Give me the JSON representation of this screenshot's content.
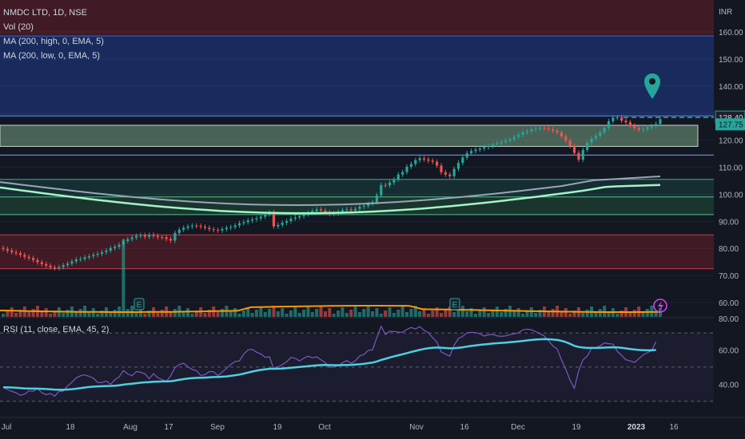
{
  "legend": {
    "symbol": "NMDC LTD, 1D, NSE",
    "volume": "Vol (20)",
    "ma_high": "MA (200, high, 0, EMA, 5)",
    "ma_low": "MA (200, low, 0, EMA, 5)"
  },
  "rsi_label": "RSI (11, close, EMA, 45, 2)",
  "colors": {
    "background": "#131722",
    "up": "#26a69a",
    "down": "#ef5350",
    "ma_high": "#9aa6b8",
    "ma_low": "#a5f3c8",
    "volume_ma": "#ff9800",
    "rsi": "#7e57c2",
    "rsi_ma": "#4dd0e1",
    "price_tag_last": "#26a69a",
    "price_tag_ref": "#1e222d"
  },
  "chart_data": [
    {
      "type": "candlestick",
      "title": "NMDC LTD, 1D, NSE",
      "currency": "INR",
      "x": [
        "Jul",
        "18",
        "Aug",
        "17",
        "Sep",
        "19",
        "Oct",
        "Nov",
        "16",
        "Dec",
        "19",
        "2023",
        "16"
      ],
      "y_ticks": [
        60,
        70,
        80,
        90,
        100,
        110,
        120,
        130,
        140,
        150,
        160
      ],
      "y_tick_labels": [
        "60.00",
        "70.00",
        "80.00",
        "90.00",
        "100.00",
        "110.00",
        "120.00",
        "130.00",
        "140.00",
        "150.00",
        "160.00"
      ],
      "ylim": [
        55,
        168
      ],
      "last_price": 127.75,
      "reference_price": 128.4,
      "closes": [
        79.8,
        79.2,
        78.6,
        78.2,
        77.6,
        76.9,
        76.4,
        75.7,
        74.9,
        74.2,
        73.6,
        73.0,
        72.7,
        73.1,
        73.8,
        74.4,
        75.2,
        75.9,
        76.1,
        76.7,
        77.1,
        77.6,
        78.0,
        78.6,
        79.2,
        80.1,
        80.6,
        81.4,
        82.7,
        83.4,
        84.0,
        84.6,
        84.9,
        84.3,
        85.0,
        84.6,
        84.2,
        84.1,
        83.5,
        82.9,
        85.7,
        86.9,
        87.6,
        88.1,
        88.4,
        88.3,
        88.0,
        87.6,
        87.1,
        86.8,
        86.6,
        87.1,
        87.6,
        87.9,
        88.5,
        89.3,
        89.7,
        90.3,
        90.7,
        91.1,
        91.7,
        92.6,
        93.3,
        88.1,
        88.7,
        89.5,
        90.1,
        91.0,
        91.4,
        91.9,
        92.6,
        93.2,
        93.8,
        94.4,
        94.0,
        93.3,
        92.7,
        92.9,
        93.6,
        94.2,
        94.4,
        94.0,
        94.6,
        95.4,
        95.7,
        96.5,
        97.1,
        99.6,
        103.4,
        103.3,
        104.3,
        105.5,
        107.3,
        108.2,
        110.2,
        111.2,
        112.6,
        113.3,
        112.9,
        112.4,
        112.0,
        110.6,
        108.1,
        107.3,
        106.7,
        109.4,
        111.6,
        113.6,
        115.2,
        116.0,
        116.5,
        116.9,
        117.4,
        117.8,
        118.4,
        118.9,
        119.3,
        119.8,
        120.3,
        121.2,
        122.0,
        122.9,
        123.3,
        124.0,
        124.2,
        124.6,
        124.4,
        124.0,
        123.5,
        122.8,
        121.4,
        119.8,
        117.8,
        115.3,
        112.8,
        116.4,
        119.0,
        120.6,
        121.6,
        122.9,
        124.6,
        127.0,
        128.3,
        128.4,
        127.2,
        126.6,
        125.4,
        124.5,
        123.8,
        124.1,
        124.8,
        125.2,
        126.0,
        127.75
      ],
      "volume_ma_label": "Vol (20)",
      "ma_high_label": "MA (200, high, 0, EMA, 5)",
      "ma_low_label": "MA (200, low, 0, EMA, 5)",
      "earnings_markers": [
        "E",
        "E"
      ]
    },
    {
      "type": "line",
      "title": "RSI (11, close, EMA, 45, 2)",
      "y_ticks": [
        40,
        60
      ],
      "y_tick_labels": [
        "40.00",
        "60.00"
      ],
      "top_tick_label": "80.00",
      "ylim": [
        28,
        78
      ],
      "series": [
        {
          "values": [
            38.2,
            36.9,
            35.8,
            35.0,
            33.4,
            34.2,
            36.1,
            35.9,
            37.4,
            35.0,
            33.8,
            34.6,
            33.0,
            35.8,
            36.0,
            39.0,
            41.2,
            43.7,
            44.9,
            45.5,
            44.6,
            43.5,
            41.0,
            40.9,
            41.9,
            39.9,
            42.6,
            44.3,
            48.0,
            46.0,
            44.9,
            47.4,
            47.0,
            46.1,
            43.2,
            46.2,
            43.8,
            42.7,
            41.7,
            44.9,
            49.6,
            51.5,
            52.3,
            50.2,
            48.6,
            47.9,
            45.1,
            45.6,
            47.4,
            47.3,
            45.0,
            47.1,
            49.3,
            51.5,
            53.3,
            53.6,
            57.6,
            60.1,
            60.4,
            58.7,
            57.7,
            55.7,
            56.1,
            48.9,
            50.2,
            51.4,
            53.1,
            55.7,
            55.1,
            53.6,
            55.2,
            56.4,
            55.4,
            56.1,
            54.2,
            52.6,
            49.9,
            50.1,
            50.8,
            52.6,
            53.8,
            52.3,
            53.7,
            56.5,
            57.4,
            59.8,
            60.1,
            67.2,
            73.9,
            69.1,
            71.0,
            70.9,
            70.5,
            70.4,
            72.1,
            73.2,
            72.3,
            73.7,
            71.5,
            70.1,
            67.2,
            64.6,
            58.9,
            57.6,
            56.4,
            62.8,
            66.8,
            68.0,
            70.1,
            70.4,
            70.2,
            69.5,
            68.2,
            68.9,
            69.1,
            68.3,
            68.0,
            68.3,
            69.0,
            69.5,
            70.1,
            71.8,
            72.2,
            71.9,
            70.8,
            69.5,
            68.2,
            65.4,
            62.4,
            60.6,
            54.2,
            48.7,
            42.3,
            37.6,
            47.9,
            54.2,
            56.4,
            60.9,
            61.4,
            62.5,
            64.2,
            63.7,
            63.4,
            59.2,
            56.9,
            54.3,
            53.6,
            52.7,
            54.9,
            57.1,
            58.4,
            59.8,
            64.8
          ]
        }
      ]
    }
  ]
}
